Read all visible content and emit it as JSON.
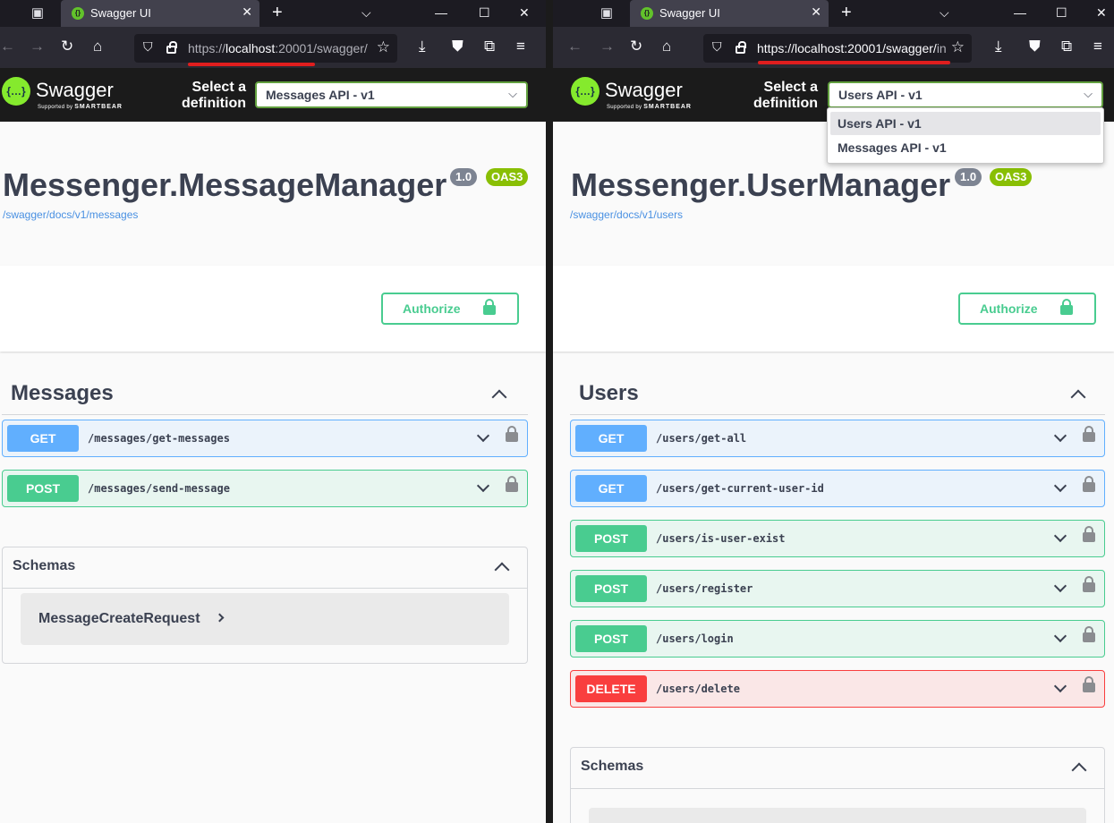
{
  "left": {
    "tab_title": "Swagger UI",
    "url_scheme": "https://",
    "url_host": "localhost",
    "url_rest": ":20001/swagger/",
    "swagger_word": "Swagger",
    "swagger_sub": "Supported by",
    "swagger_sub_brand": "SMARTBEAR",
    "select_label_1": "Select a",
    "select_label_2": "definition",
    "selected_definition": "Messages API - v1",
    "title": "Messenger.MessageManager",
    "version": "1.0",
    "oas": "OAS3",
    "spec_link": "/swagger/docs/v1/messages",
    "authorize": "Authorize",
    "tag": "Messages",
    "operations": [
      {
        "method": "GET",
        "path": "/messages/get-messages"
      },
      {
        "method": "POST",
        "path": "/messages/send-message"
      }
    ],
    "schemas_title": "Schemas",
    "schema_models": [
      "MessageCreateRequest"
    ]
  },
  "right": {
    "tab_title": "Swagger UI",
    "url_scheme": "https://",
    "url_host": "localhost:20001/swagger/",
    "url_rest": "in",
    "swagger_word": "Swagger",
    "swagger_sub": "Supported by",
    "swagger_sub_brand": "SMARTBEAR",
    "select_label_1": "Select a",
    "select_label_2": "definition",
    "selected_definition": "Users API - v1",
    "dropdown_options": [
      "Users API - v1",
      "Messages API - v1"
    ],
    "title": "Messenger.UserManager",
    "version": "1.0",
    "oas": "OAS3",
    "spec_link": "/swagger/docs/v1/users",
    "authorize": "Authorize",
    "tag": "Users",
    "operations": [
      {
        "method": "GET",
        "path": "/users/get-all"
      },
      {
        "method": "GET",
        "path": "/users/get-current-user-id"
      },
      {
        "method": "POST",
        "path": "/users/is-user-exist"
      },
      {
        "method": "POST",
        "path": "/users/register"
      },
      {
        "method": "POST",
        "path": "/users/login"
      },
      {
        "method": "DELETE",
        "path": "/users/delete"
      }
    ],
    "schemas_title": "Schemas"
  },
  "icons": {
    "list_all_tabs": "list-tabs-icon",
    "new_tab": "+",
    "close": "✕",
    "chevron": "⌵"
  },
  "colors": {
    "get": "#61affe",
    "post": "#49cc90",
    "delete": "#f93e3e",
    "swagger_green": "#85ea2d",
    "annotation_red": "#e01e1e"
  }
}
